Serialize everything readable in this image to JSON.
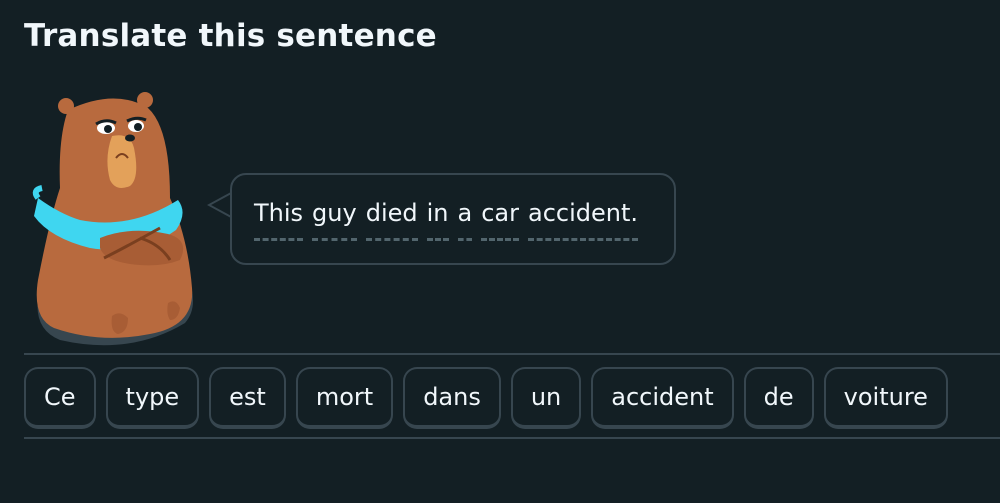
{
  "header": {
    "title": "Translate this sentence"
  },
  "prompt": {
    "words": [
      "This",
      "guy",
      "died",
      "in",
      "a",
      "car",
      "accident."
    ]
  },
  "word_bank": {
    "tiles": [
      "Ce",
      "type",
      "est",
      "mort",
      "dans",
      "un",
      "accident",
      "de",
      "voiture"
    ]
  },
  "colors": {
    "background": "#131f24",
    "border": "#37464f",
    "text": "#f1f7fb",
    "bear_fur": "#b86a3e",
    "bear_snout": "#e3a15a",
    "scarf": "#3fd6f0"
  },
  "icons": {
    "mascot": "bear-character"
  }
}
